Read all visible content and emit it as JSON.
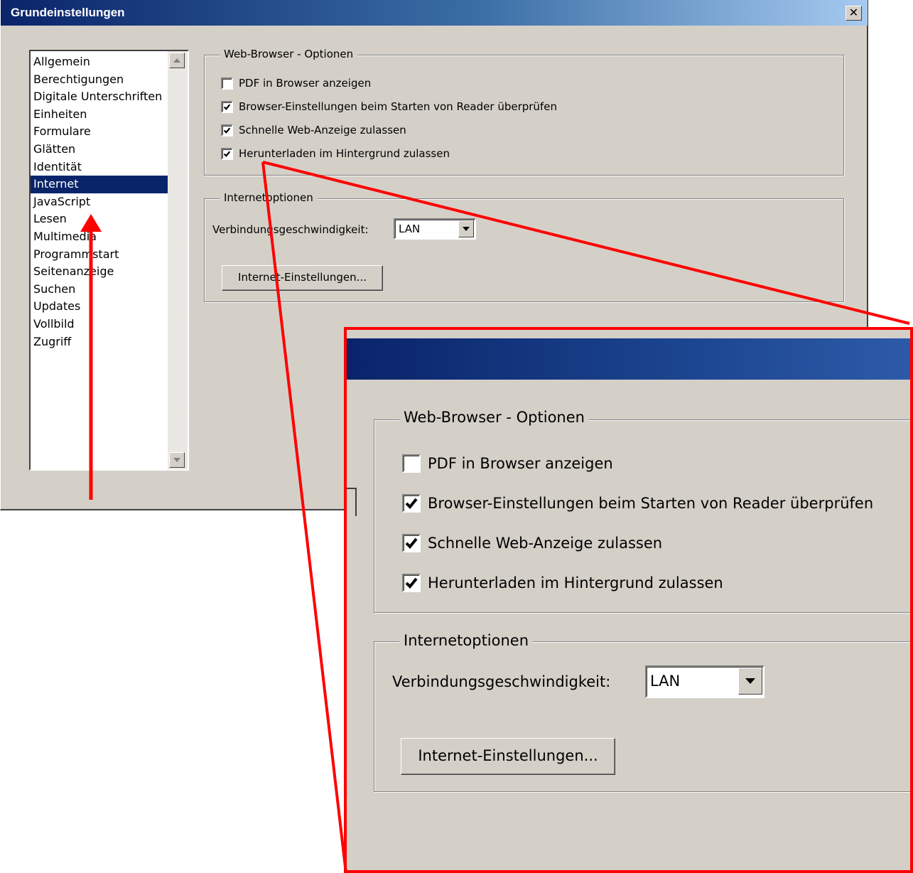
{
  "dialog": {
    "title": "Grundeinstellungen",
    "close_glyph": "✕"
  },
  "categories": [
    {
      "label": "Allgemein",
      "selected": false
    },
    {
      "label": "Berechtigungen",
      "selected": false
    },
    {
      "label": "Digitale Unterschriften",
      "selected": false
    },
    {
      "label": "Einheiten",
      "selected": false
    },
    {
      "label": "Formulare",
      "selected": false
    },
    {
      "label": "Glätten",
      "selected": false
    },
    {
      "label": "Identität",
      "selected": false
    },
    {
      "label": "Internet",
      "selected": true
    },
    {
      "label": "JavaScript",
      "selected": false
    },
    {
      "label": "Lesen",
      "selected": false
    },
    {
      "label": "Multimedia",
      "selected": false
    },
    {
      "label": "Programmstart",
      "selected": false
    },
    {
      "label": "Seitenanzeige",
      "selected": false
    },
    {
      "label": "Suchen",
      "selected": false
    },
    {
      "label": "Updates",
      "selected": false
    },
    {
      "label": "Vollbild",
      "selected": false
    },
    {
      "label": "Zugriff",
      "selected": false
    }
  ],
  "web_browser": {
    "legend": "Web-Browser - Optionen",
    "options": [
      {
        "label": "PDF in Browser anzeigen",
        "checked": false
      },
      {
        "label": "Browser-Einstellungen beim Starten von Reader überprüfen",
        "checked": true
      },
      {
        "label": "Schnelle Web-Anzeige zulassen",
        "checked": true
      },
      {
        "label": "Herunterladen im Hintergrund zulassen",
        "checked": true
      }
    ]
  },
  "internet_options": {
    "legend": "Internetoptionen",
    "speed_label": "Verbindungsgeschwindigkeit:",
    "speed_value": "LAN",
    "settings_button": "Internet-Einstellungen..."
  },
  "annotation_color": "#ff0000",
  "icons": {
    "checkmark": "checkmark-icon",
    "dropdown": "chevron-down-icon",
    "scroll_up": "scroll-up-arrow-icon",
    "scroll_down": "scroll-down-arrow-icon",
    "close": "close-icon"
  }
}
